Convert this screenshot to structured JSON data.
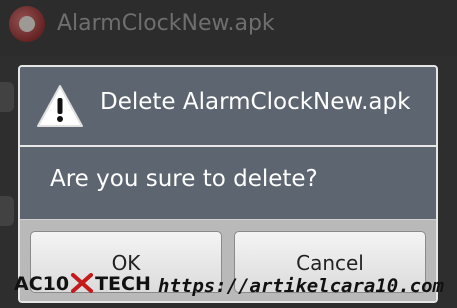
{
  "background_list": {
    "item_title": "AlarmClockNew.apk",
    "item_icon": "alarm-clock-icon"
  },
  "dialog": {
    "icon": "warning-icon",
    "title": "Delete AlarmClockNew.apk",
    "message": "Are you sure to delete?",
    "ok_label": "OK",
    "cancel_label": "Cancel"
  },
  "watermark": {
    "logo_prefix": "AC10",
    "logo_suffix": "TECH",
    "url": "https://artikelcara10.com"
  },
  "colors": {
    "dialog_bg": "#5d6670",
    "button_bar": "#b9b9b9",
    "warning_yellow": "#f2c200"
  }
}
